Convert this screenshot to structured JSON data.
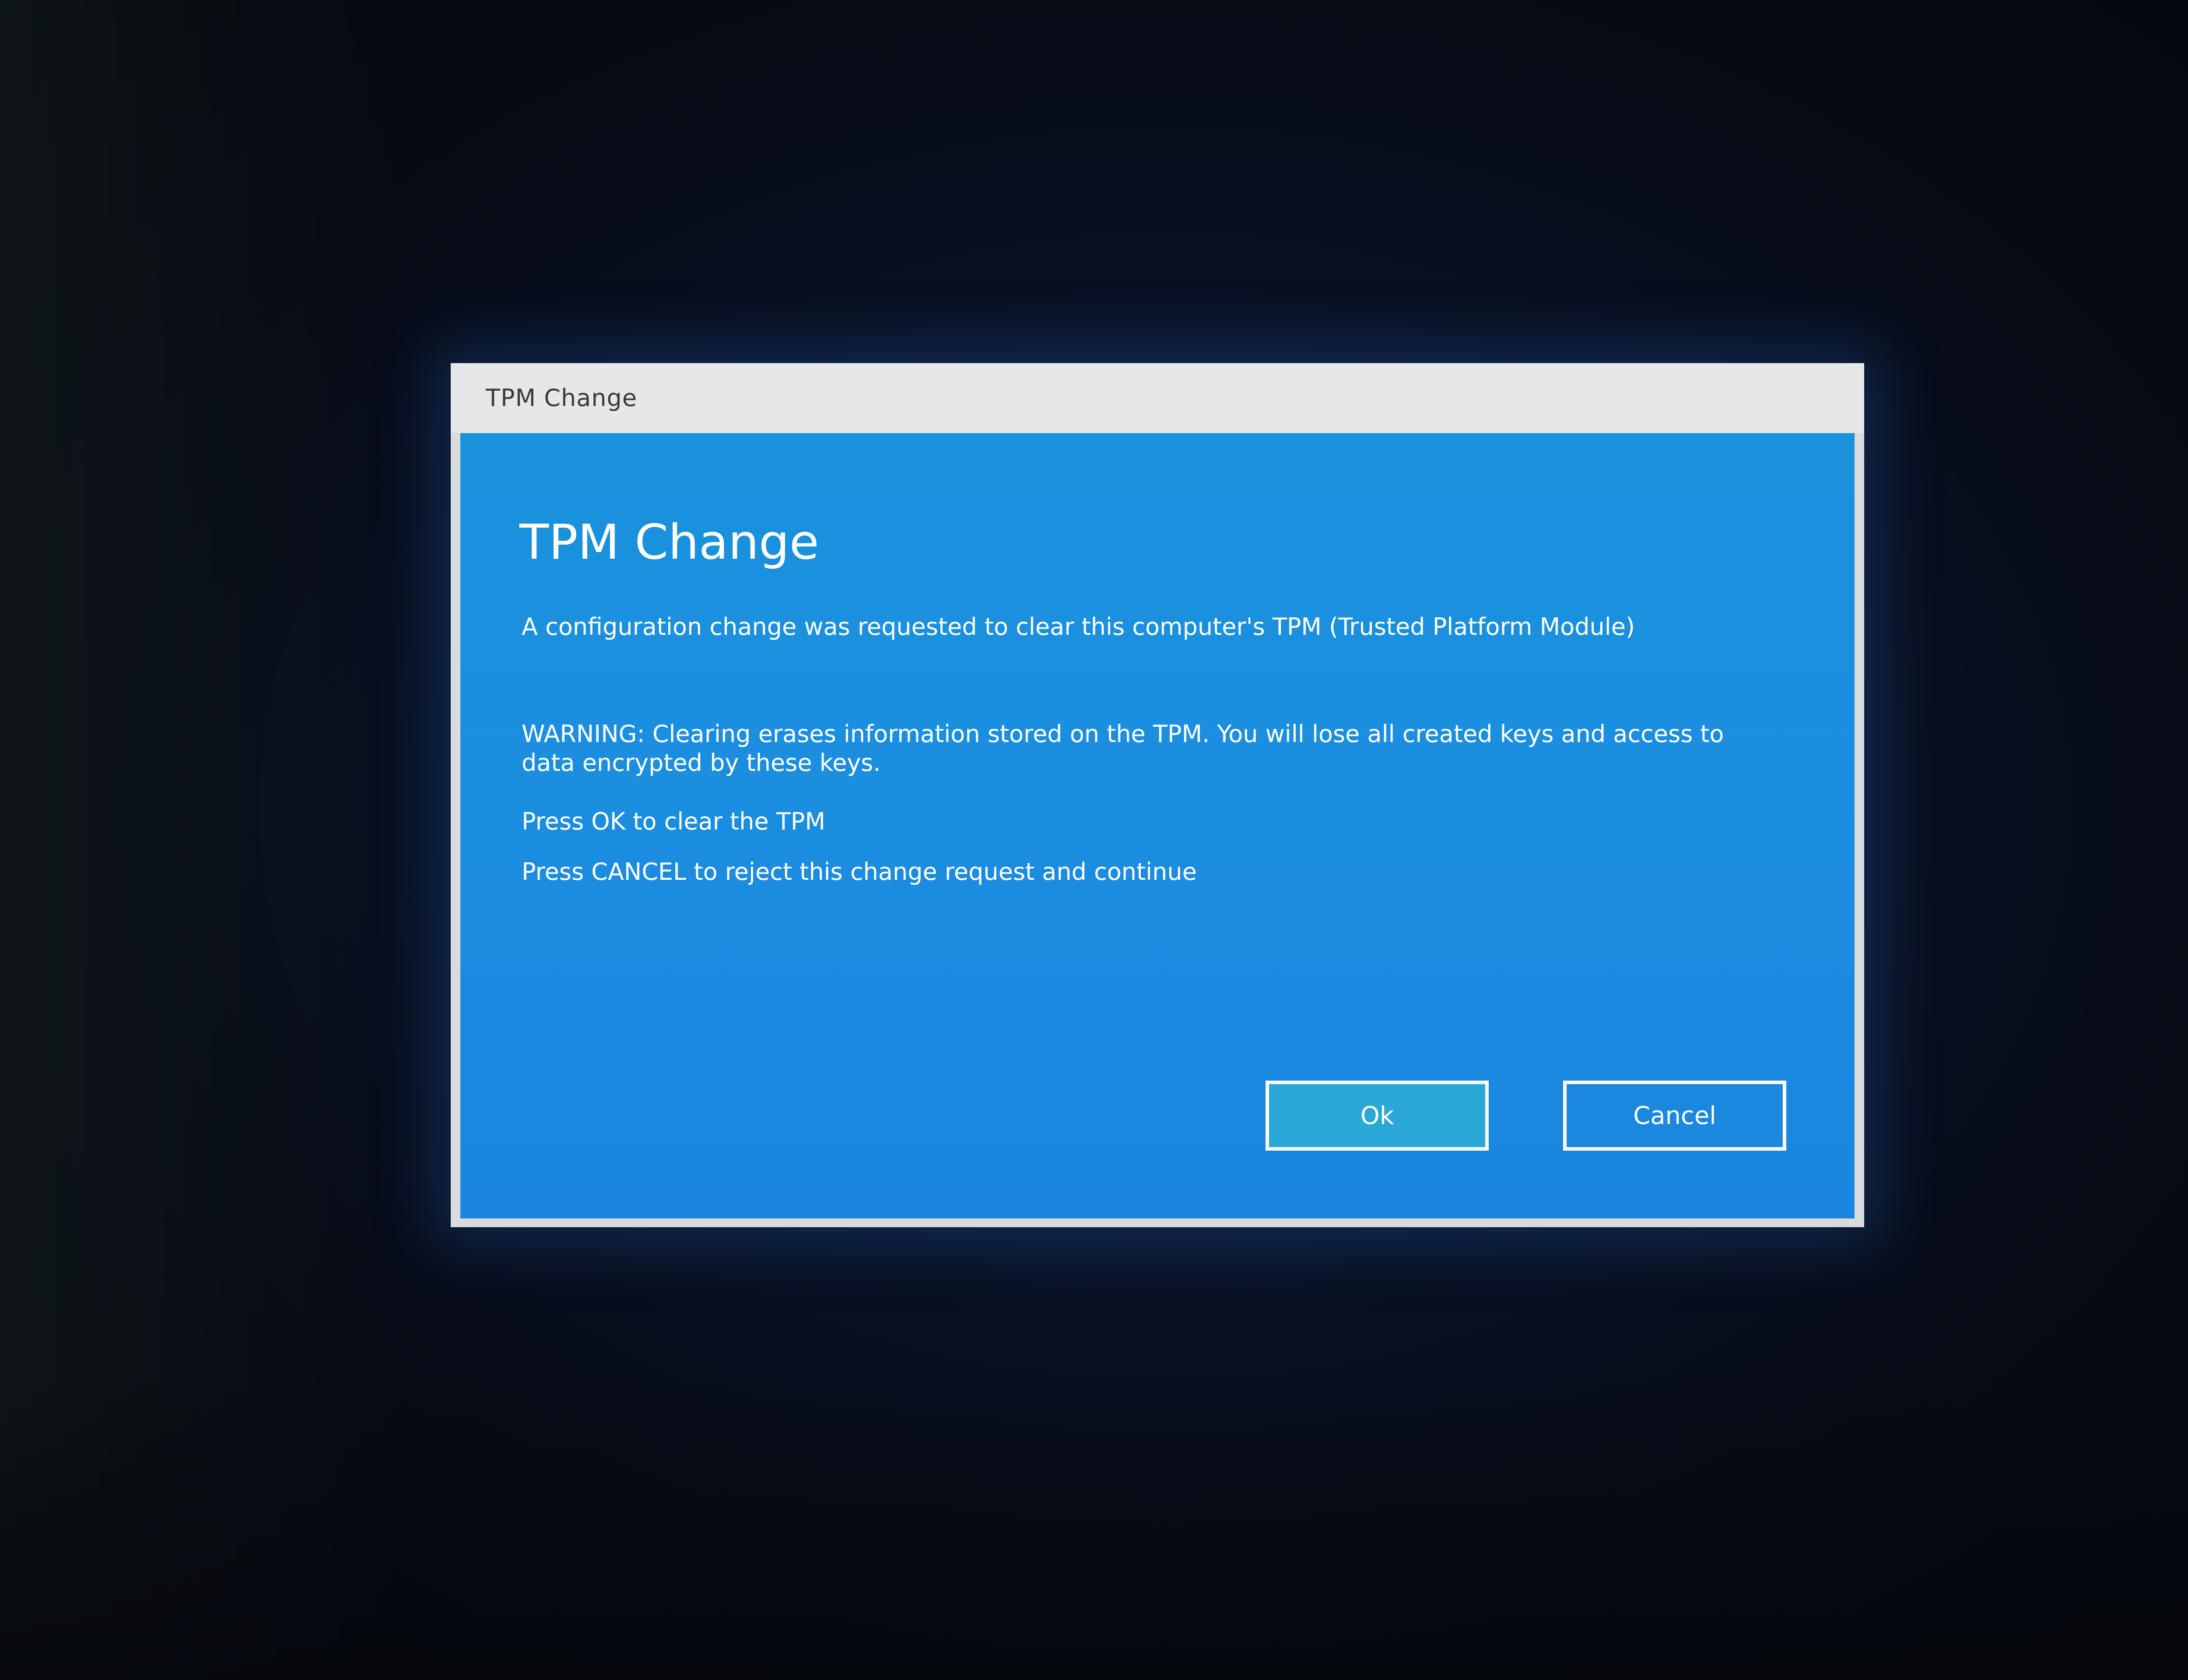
{
  "window": {
    "title": "TPM Change"
  },
  "dialog": {
    "heading": "TPM Change",
    "config_text": "A configuration change was requested to clear this computer's TPM (Trusted Platform Module)",
    "warning_text": "WARNING: Clearing erases information stored on the TPM. You will lose all created keys and access to data encrypted by these keys.",
    "ok_instruction": "Press OK to clear the TPM",
    "cancel_instruction": "Press CANCEL to reject this change request and continue"
  },
  "buttons": {
    "ok_label": "Ok",
    "cancel_label": "Cancel"
  },
  "colors": {
    "dialog_background": "#1a8fdd",
    "titlebar": "#e6e7e9",
    "ok_button": "#2aa8d8",
    "text": "#ffffff"
  }
}
